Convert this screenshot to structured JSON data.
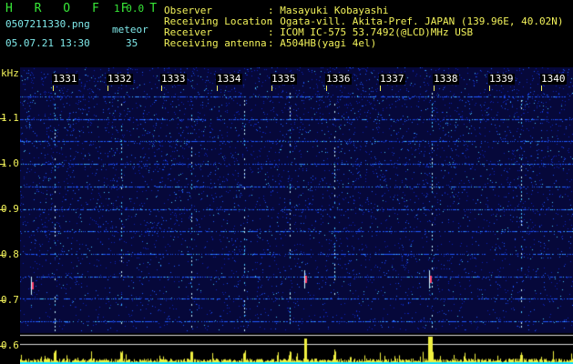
{
  "app": {
    "title": "H R O F F T",
    "version": "1.0.0",
    "filename": "0507211330.png",
    "datetime": "05.07.21 13:30",
    "meteor_label": "meteor",
    "meteor_count": "35"
  },
  "info": {
    "labels": [
      "Observer",
      "Receiving Location",
      "Receiver",
      "Receiving antenna"
    ],
    "values": [
      ": Masayuki Kobayashi",
      ": Ogata-vill. Akita-Pref. JAPAN (139.96E, 40.02N)",
      ": ICOM IC-575 53.7492(@LCD)MHz USB",
      ": A504HB(yagi 4el)"
    ]
  },
  "spectrogram": {
    "freq_unit": "kHz",
    "freq_ticks": [
      "1.1",
      "1.0",
      "0.9",
      "0.8",
      "0.7",
      "0.6"
    ],
    "minute_labels": [
      "1331",
      "1332",
      "1333",
      "1334",
      "1335",
      "1336",
      "1337",
      "1338",
      "1339",
      "1340"
    ],
    "colors": {
      "background": "#06083a",
      "noise_low": "#0d22b8",
      "noise_mid": "#1f58ff",
      "noise_high": "#46c6ff",
      "echo": "#c8f5ff",
      "meteor_head": "#ff3f6a",
      "profile_fill": "#f0f040",
      "profile_base": "#16e0ff",
      "axis": "#f2f25a"
    }
  }
}
